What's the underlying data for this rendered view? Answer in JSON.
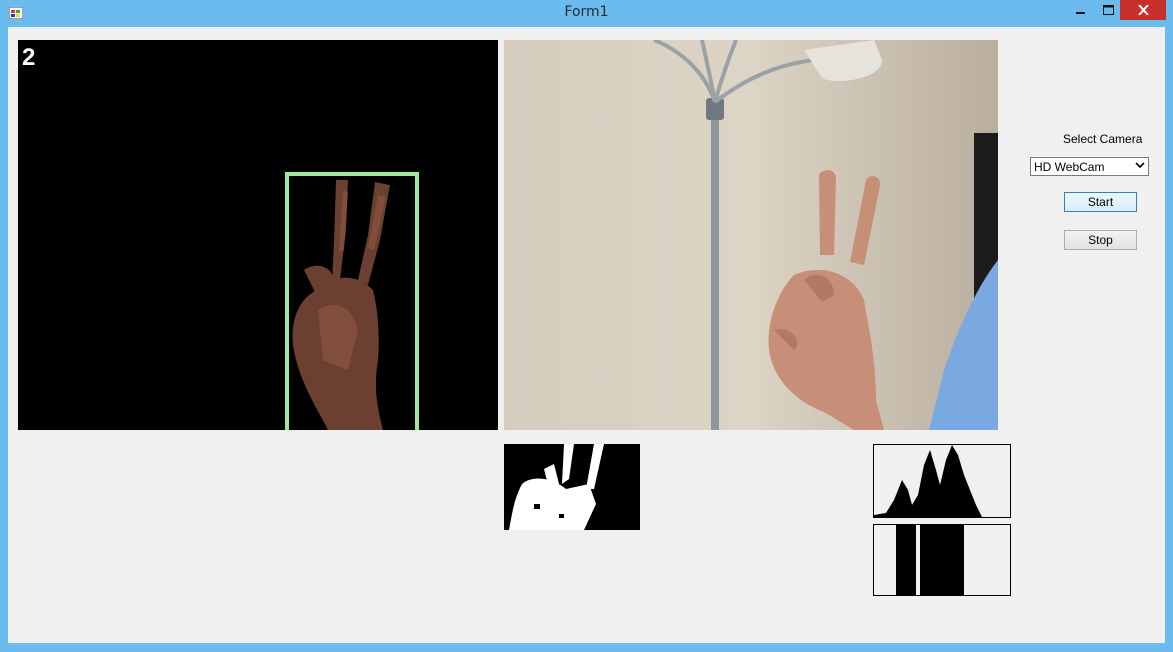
{
  "window": {
    "title": "Form1",
    "icon": "winforms-app-icon",
    "controls": {
      "minimize": "minimize-icon",
      "maximize": "maximize-icon",
      "close": "close-icon"
    }
  },
  "result_view": {
    "finger_count": "2",
    "bounding_box_color": "#9fe89c"
  },
  "camera_panel": {
    "label": "Select Camera",
    "selected_camera": "HD WebCam",
    "start_label": "Start",
    "stop_label": "Stop"
  },
  "colors": {
    "titlebar": "#6cbbee",
    "close_button": "#c7302d",
    "client_bg": "#f0f0f0"
  }
}
